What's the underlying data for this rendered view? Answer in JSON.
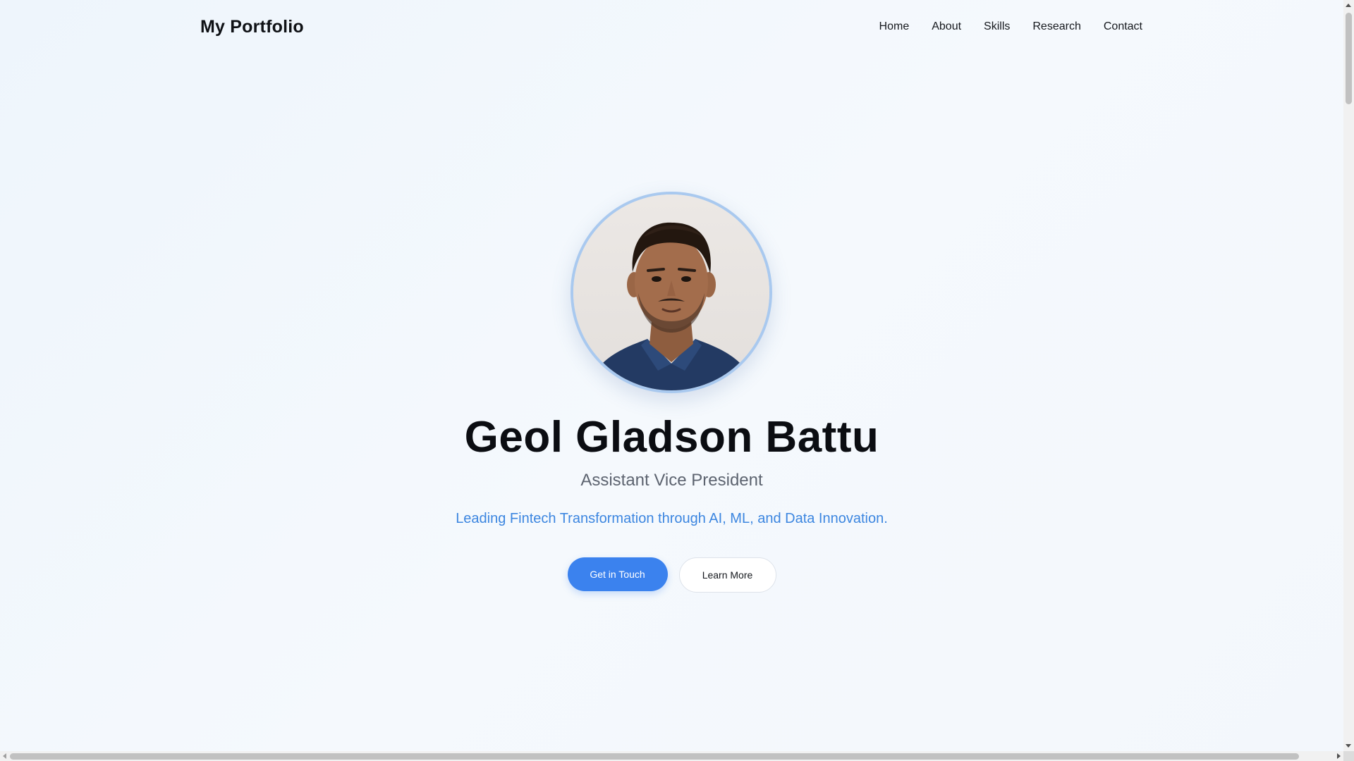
{
  "navbar": {
    "brand": "My Portfolio",
    "links": [
      "Home",
      "About",
      "Skills",
      "Research",
      "Contact"
    ]
  },
  "hero": {
    "avatar_icon": "profile-photo",
    "name": "Geol Gladson Battu",
    "role": "Assistant Vice President",
    "tagline": "Leading Fintech Transformation through AI, ML, and Data Innovation.",
    "primary_button": "Get in Touch",
    "secondary_button": "Learn More"
  },
  "colors": {
    "accent": "#3b82ee",
    "tagline": "#3c86e0",
    "avatar_ring": "#a9c9ef",
    "background": "#f2f7fc"
  }
}
